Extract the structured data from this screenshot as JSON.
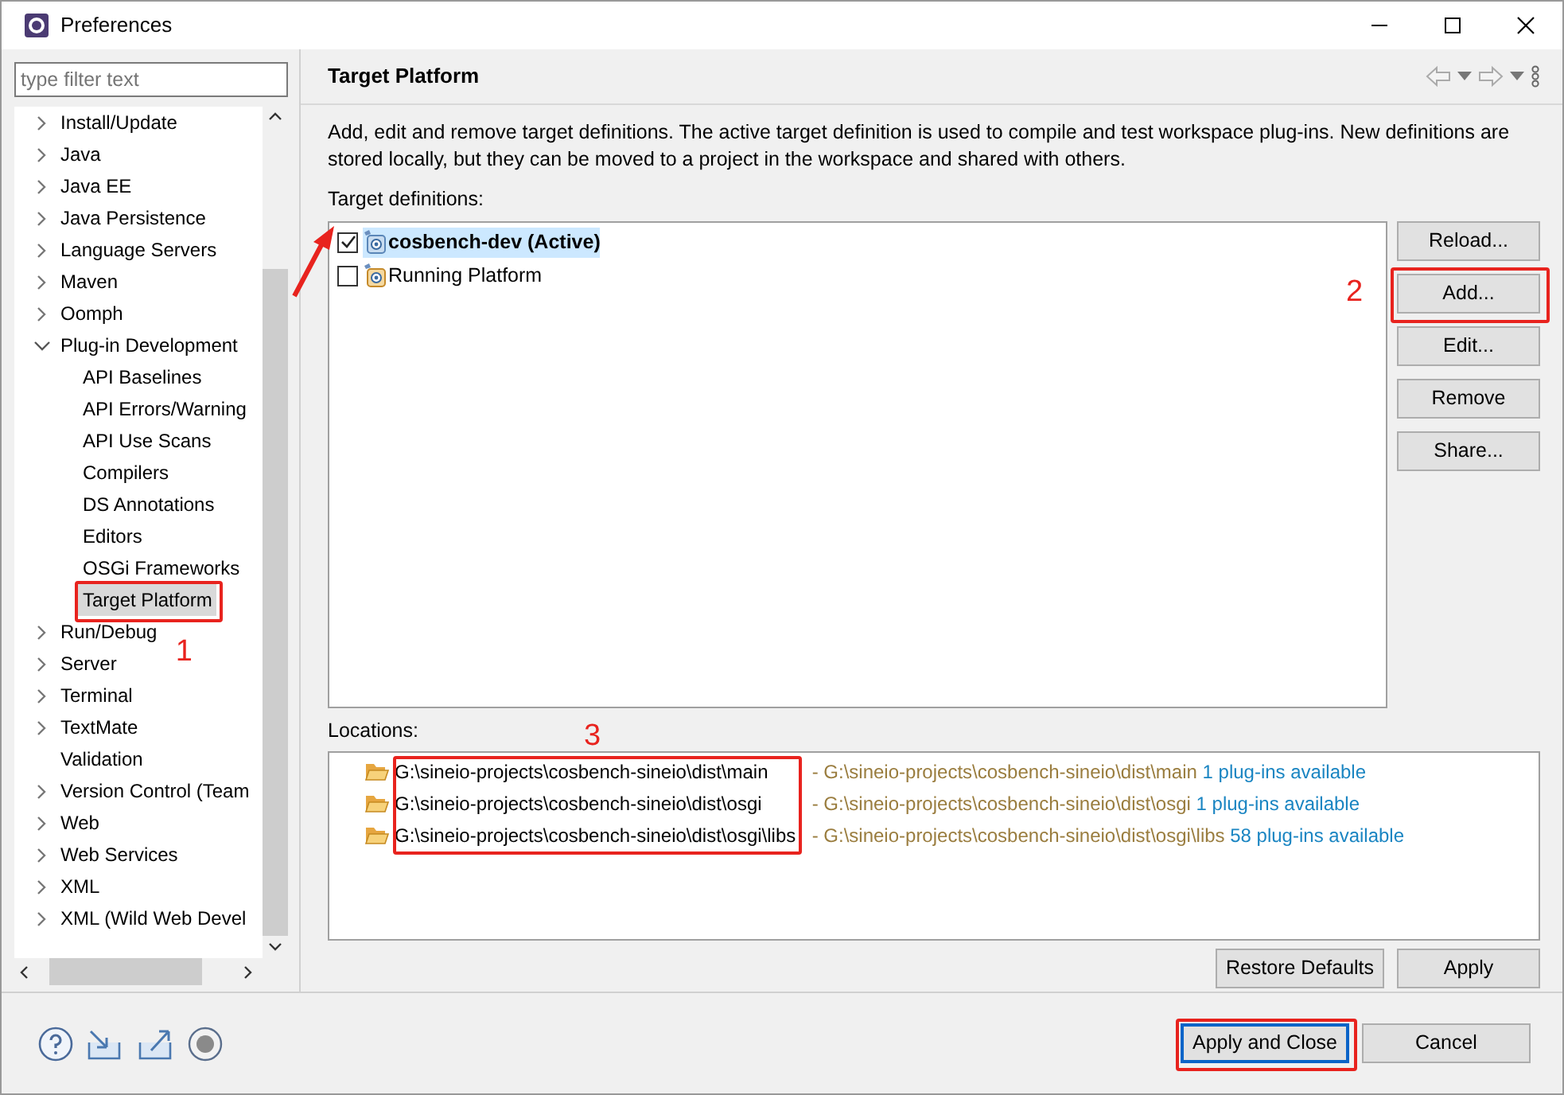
{
  "window": {
    "title": "Preferences"
  },
  "filter": {
    "placeholder": "type filter text"
  },
  "sidebar": {
    "items": [
      {
        "label": "Install/Update",
        "kind": "node",
        "expanded": false,
        "selected": false
      },
      {
        "label": "Java",
        "kind": "node",
        "expanded": false,
        "selected": false
      },
      {
        "label": "Java EE",
        "kind": "node",
        "expanded": false,
        "selected": false
      },
      {
        "label": "Java Persistence",
        "kind": "node",
        "expanded": false,
        "selected": false
      },
      {
        "label": "Language Servers",
        "kind": "node",
        "expanded": false,
        "selected": false
      },
      {
        "label": "Maven",
        "kind": "node",
        "expanded": false,
        "selected": false
      },
      {
        "label": "Oomph",
        "kind": "node",
        "expanded": false,
        "selected": false
      },
      {
        "label": "Plug-in Development",
        "kind": "node",
        "expanded": true,
        "selected": false,
        "children": [
          {
            "label": "API Baselines",
            "selected": false
          },
          {
            "label": "API Errors/Warning",
            "selected": false
          },
          {
            "label": "API Use Scans",
            "selected": false
          },
          {
            "label": "Compilers",
            "selected": false
          },
          {
            "label": "DS Annotations",
            "selected": false
          },
          {
            "label": "Editors",
            "selected": false
          },
          {
            "label": "OSGi Frameworks",
            "selected": false
          },
          {
            "label": "Target Platform",
            "selected": true
          }
        ]
      },
      {
        "label": "Run/Debug",
        "kind": "node",
        "expanded": false,
        "selected": false
      },
      {
        "label": "Server",
        "kind": "node",
        "expanded": false,
        "selected": false
      },
      {
        "label": "Terminal",
        "kind": "node",
        "expanded": false,
        "selected": false
      },
      {
        "label": "TextMate",
        "kind": "node",
        "expanded": false,
        "selected": false
      },
      {
        "label": "Validation",
        "kind": "leaf",
        "selected": false
      },
      {
        "label": "Version Control (Team",
        "kind": "node",
        "expanded": false,
        "selected": false
      },
      {
        "label": "Web",
        "kind": "node",
        "expanded": false,
        "selected": false
      },
      {
        "label": "Web Services",
        "kind": "node",
        "expanded": false,
        "selected": false
      },
      {
        "label": "XML",
        "kind": "node",
        "expanded": false,
        "selected": false
      },
      {
        "label": "XML (Wild Web Devel",
        "kind": "node",
        "expanded": false,
        "selected": false
      }
    ]
  },
  "page": {
    "title": "Target Platform",
    "description": "Add, edit and remove target definitions.  The active target definition is used to compile and test workspace plug-ins.  New definitions are stored locally, but they can be moved to a project in the workspace and shared with others.",
    "targets_label": "Target definitions:",
    "targets": [
      {
        "label": "cosbench-dev (Active)",
        "checked": true,
        "active": true
      },
      {
        "label": "Running Platform",
        "checked": false,
        "active": false
      }
    ],
    "target_buttons": [
      "Reload...",
      "Add...",
      "Edit...",
      "Remove",
      "Share..."
    ],
    "locations_label": "Locations:",
    "locations": [
      {
        "path": "G:\\sineio-projects\\cosbench-sineio\\dist\\main",
        "detail": " - G:\\sineio-projects\\cosbench-sineio\\dist\\main",
        "count": "1 plug-ins available"
      },
      {
        "path": "G:\\sineio-projects\\cosbench-sineio\\dist\\osgi",
        "detail": " - G:\\sineio-projects\\cosbench-sineio\\dist\\osgi",
        "count": "1 plug-ins available"
      },
      {
        "path": "G:\\sineio-projects\\cosbench-sineio\\dist\\osgi\\libs",
        "detail": " - G:\\sineio-projects\\cosbench-sineio\\dist\\osgi\\libs",
        "count": "58 plug-ins available"
      }
    ],
    "page_buttons": [
      "Restore Defaults",
      "Apply"
    ]
  },
  "footer_buttons": [
    {
      "label": "Apply and Close",
      "default": true
    },
    {
      "label": "Cancel",
      "default": false
    }
  ],
  "annotations": [
    {
      "label": "1"
    },
    {
      "label": "2"
    },
    {
      "label": "3"
    }
  ]
}
